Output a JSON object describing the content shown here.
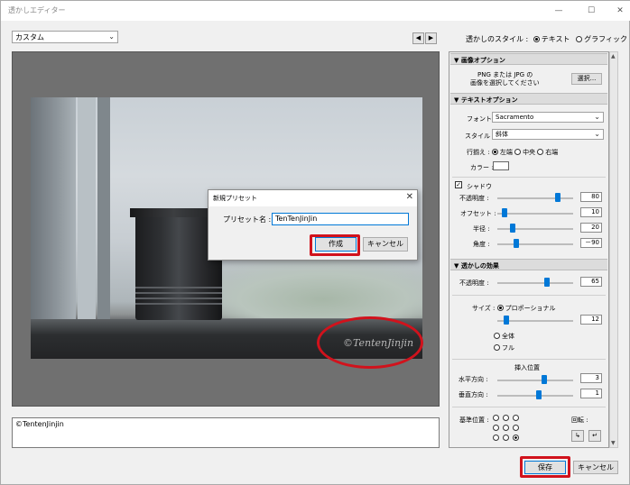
{
  "window": {
    "title": "透かしエディター",
    "min": "—",
    "max": "☐",
    "close": "✕"
  },
  "preset": {
    "value": "カスタム"
  },
  "nav": {
    "prev": "◀",
    "next": "▶"
  },
  "style": {
    "label": "透かしのスタイル :",
    "text_opt": "テキスト",
    "graphic_opt": "グラフィック",
    "selected": "テキスト"
  },
  "watermark_text": "©TentenJinjin",
  "dialog": {
    "title": "新規プリセット",
    "name_label": "プリセット名 :",
    "name_value": "TenTenJinJin",
    "create": "作成",
    "cancel": "キャンセル"
  },
  "bottom_text": "©TentenJinjin",
  "image_options": {
    "header": "画像オプション",
    "desc_line1": "PNG または JPG の",
    "desc_line2": "画像を選択してください",
    "choose": "選択..."
  },
  "text_options": {
    "header": "テキストオプション",
    "font_label": "フォント :",
    "font_value": "Sacramento",
    "style_label": "スタイル :",
    "style_value": "斜体",
    "align_label": "行揃え :",
    "align_left": "左端",
    "align_center": "中央",
    "align_right": "右端",
    "color_label": "カラー :",
    "shadow_label": "シャドウ",
    "shadow_checked": "✓",
    "opacity_label": "不透明度 :",
    "opacity_value": "80",
    "opacity_level": 0.8,
    "offset_label": "オフセット :",
    "offset_value": "10",
    "offset_level": 0.1,
    "radius_label": "半径 :",
    "radius_value": "20",
    "radius_level": 0.2,
    "angle_label": "角度 :",
    "angle_value": "－90",
    "angle_level": 0.25
  },
  "effects": {
    "header": "透かしの効果",
    "opacity_label": "不透明度 :",
    "opacity_value": "65",
    "opacity_level": 0.65,
    "size_label": "サイズ :",
    "size_proportional": "プロポーショナル",
    "size_value": "12",
    "size_level": 0.12,
    "fit": "全体",
    "fill": "フル",
    "inset_label": "挿入位置",
    "horiz_label": "水平方向 :",
    "horiz_value": "3",
    "horiz_level": 0.62,
    "vert_label": "垂直方向 :",
    "vert_value": "1",
    "vert_level": 0.55,
    "anchor_label": "基準位置 :",
    "rotate_label": "回転 :",
    "rotate_cw": "↳",
    "rotate_ccw": "↵"
  },
  "footer": {
    "save": "保存",
    "cancel": "キャンセル"
  },
  "colors": {
    "accent": "#0078d7",
    "highlight": "#d1121c"
  }
}
